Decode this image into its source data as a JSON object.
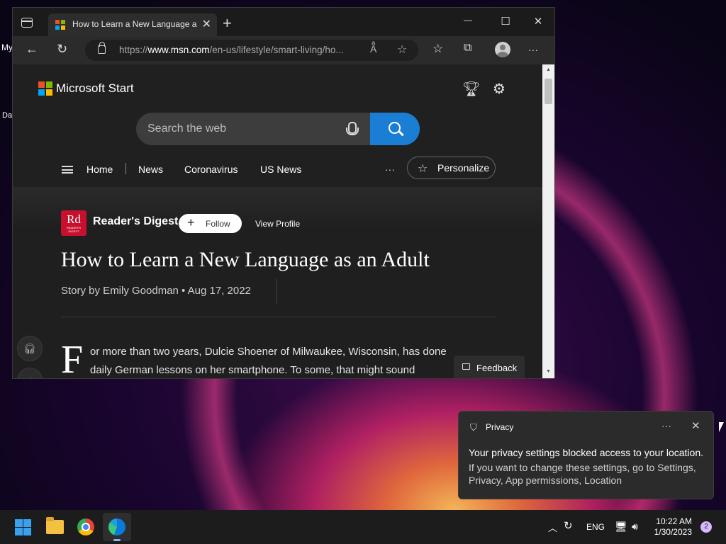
{
  "desktop": {
    "icon1_label": "My",
    "icon2_label": "Da"
  },
  "browser": {
    "tab": {
      "title": "How to Learn a New Language as an Adult",
      "close": "✕"
    },
    "new_tab": "+",
    "window_controls": {
      "minimize": "—",
      "maximize": "☐",
      "close": "✕"
    },
    "toolbar": {
      "url_prefix": "https://",
      "url_domain": "www.msn.com",
      "url_path": "/en-us/lifestyle/smart-living/ho...",
      "more": "···"
    }
  },
  "page": {
    "brand": "Microsoft Start",
    "search_placeholder": "Search the web",
    "nav": {
      "home": "Home",
      "items": [
        "News",
        "Coronavirus",
        "US News"
      ],
      "more": "···",
      "personalize": "Personalize"
    },
    "article": {
      "publisher_logo": "Rd",
      "publisher_logo_sub": "READER'S DIGEST",
      "publisher": "Reader's Digest",
      "follow_label": "Follow",
      "view_profile_label": "View Profile",
      "headline": "How to Learn a New Language as an Adult",
      "byline": "Story by Emily Goodman • Aug 17, 2022",
      "dropcap": "F",
      "body_line1": "or more than two years, Dulcie Shoener of Milwaukee, Wisconsin, has done",
      "body_line2": "daily German lessons on her smartphone. To some, that might sound"
    },
    "feedback_label": "Feedback"
  },
  "toast": {
    "title": "Privacy",
    "more": "···",
    "close": "✕",
    "message": "Your privacy settings blocked access to your location.",
    "detail": "If you want to change these settings, go to Settings, Privacy, App permissions, Location"
  },
  "taskbar": {
    "language": "ENG",
    "time": "10:22 AM",
    "date": "1/30/2023",
    "notification_count": "2"
  },
  "colors": {
    "accent": "#1a7fd4",
    "publisher_red": "#c8102e"
  }
}
